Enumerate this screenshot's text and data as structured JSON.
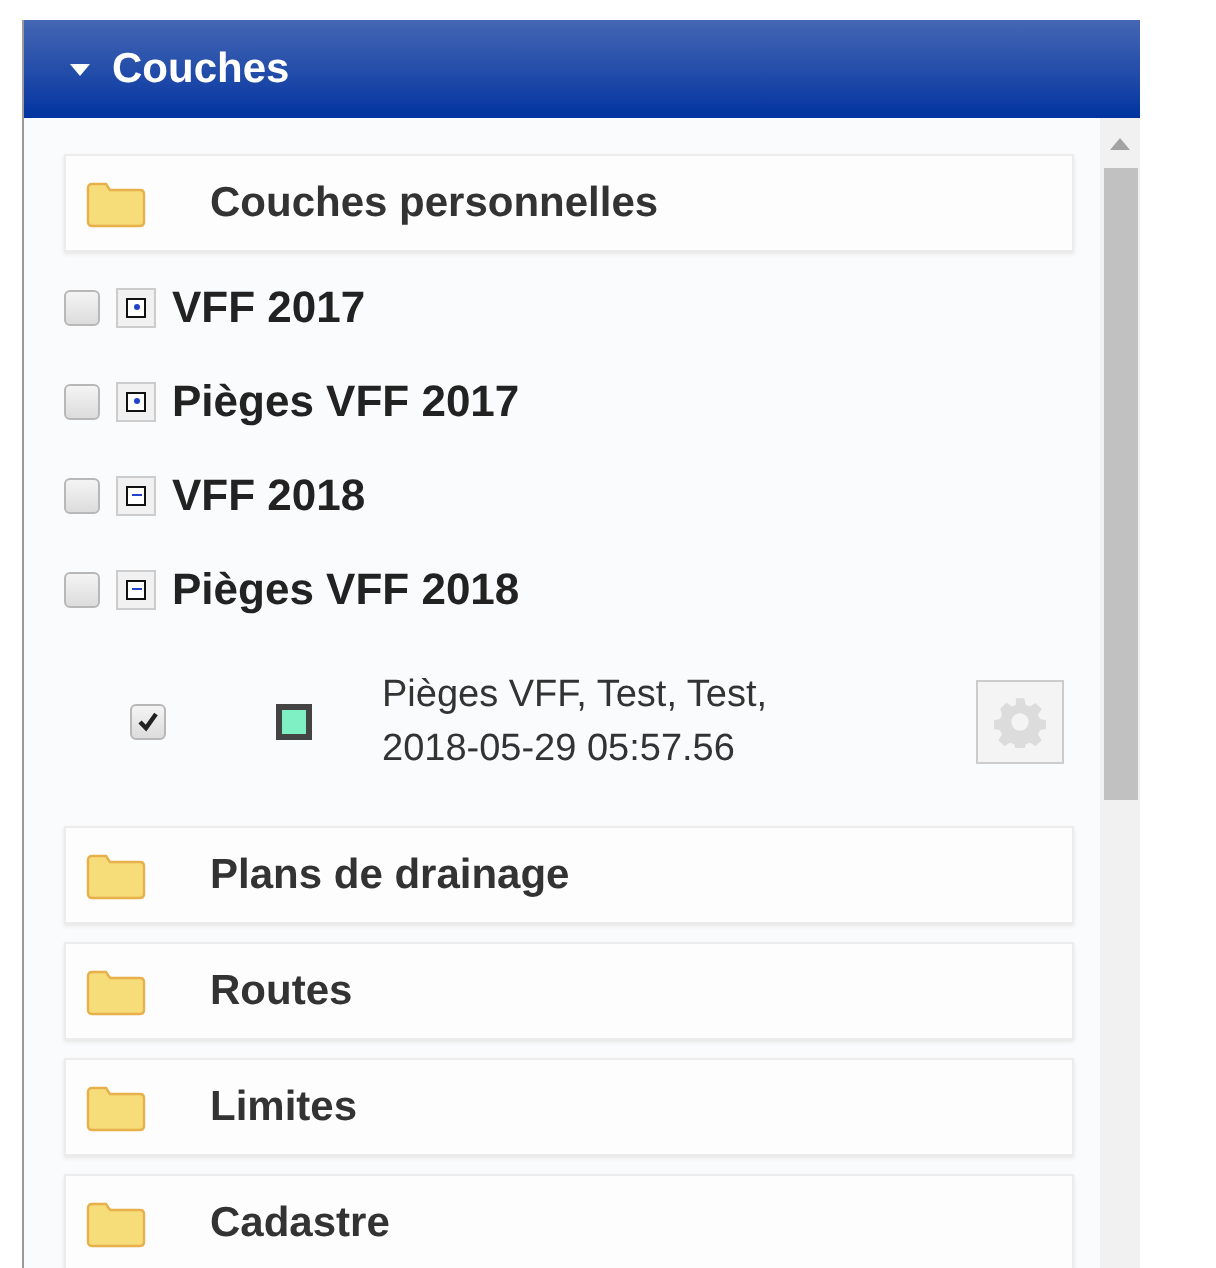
{
  "panel": {
    "title": "Couches",
    "expanded": true
  },
  "items": [
    {
      "kind": "folder",
      "label": "Couches personnelles"
    },
    {
      "kind": "layer",
      "label": "VFF 2017",
      "checked": false,
      "expanded": false
    },
    {
      "kind": "layer",
      "label": "Pièges VFF 2017",
      "checked": false,
      "expanded": false
    },
    {
      "kind": "layer",
      "label": "VFF 2018",
      "checked": false,
      "expanded": true
    },
    {
      "kind": "layer",
      "label": "Pièges VFF 2018",
      "checked": false,
      "expanded": true
    },
    {
      "kind": "sublayer",
      "label": "Pièges VFF, Test, Test, 2018-05-29 05:57.56",
      "checked": true,
      "color": "#7ff0c4"
    },
    {
      "kind": "folder",
      "label": "Plans de drainage"
    },
    {
      "kind": "folder",
      "label": "Routes"
    },
    {
      "kind": "folder",
      "label": "Limites"
    },
    {
      "kind": "folder",
      "label": "Cadastre"
    }
  ]
}
